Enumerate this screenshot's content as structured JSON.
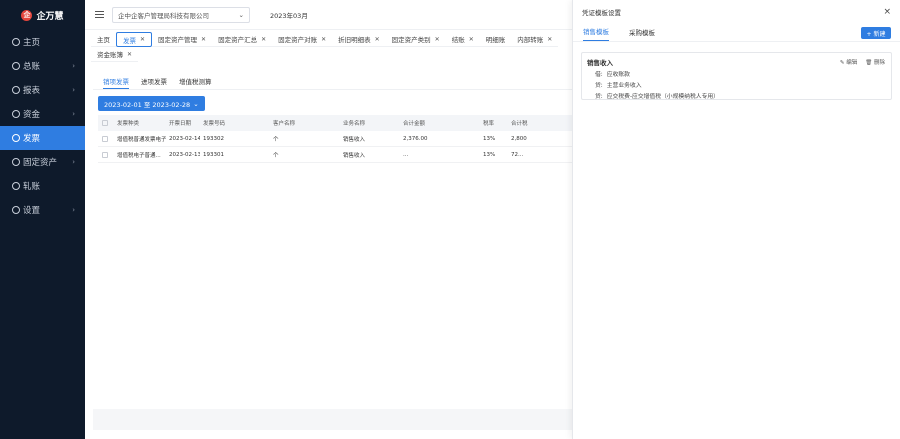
{
  "sidebar": {
    "logo": "企万慧",
    "items": [
      {
        "label": "主页",
        "arrow": ""
      },
      {
        "label": "总账",
        "arrow": "›"
      },
      {
        "label": "报表",
        "arrow": "›"
      },
      {
        "label": "资金",
        "arrow": "›"
      },
      {
        "label": "发票",
        "arrow": ""
      },
      {
        "label": "固定资产",
        "arrow": "›"
      },
      {
        "label": "轧账",
        "arrow": ""
      },
      {
        "label": "设置",
        "arrow": "›"
      }
    ]
  },
  "topbar": {
    "company": "企中企客户管理局科技有限公司",
    "period": "2023年03月"
  },
  "tabs": [
    {
      "label": "主页",
      "closable": false
    },
    {
      "label": "发票",
      "closable": true
    },
    {
      "label": "固定资产管理",
      "closable": true
    },
    {
      "label": "固定资产汇总",
      "closable": true
    },
    {
      "label": "固定资产对账",
      "closable": true
    },
    {
      "label": "折旧明细表",
      "closable": true
    },
    {
      "label": "固定资产类别",
      "closable": true
    },
    {
      "label": "结账",
      "closable": true
    },
    {
      "label": "明细账",
      "closable": false
    },
    {
      "label": "内部转账",
      "closable": true
    },
    {
      "label": "资金账簿",
      "closable": true
    }
  ],
  "subtabs": [
    "销项发票",
    "进项发票",
    "增值税测算"
  ],
  "date_range": "2023-02-01 至 2023-02-28",
  "table": {
    "headers": [
      "发票种类",
      "开票日期",
      "发票号码",
      "客户名称",
      "业务名称",
      "合计金额",
      "税率",
      "合计税"
    ],
    "rows": [
      [
        "增值税普通发票电子...",
        "2023-02-14",
        "193302",
        "个",
        "销售收入",
        "2,376.00",
        "13%",
        "2,800"
      ],
      [
        "增值税电子普通...",
        "2023-02-13",
        "193301",
        "个",
        "销售收入",
        "...",
        "13%",
        "72..."
      ]
    ]
  },
  "drawer": {
    "title": "凭证模板设置",
    "close": "×",
    "tabs": [
      "销售模板",
      "采购模板"
    ],
    "new_button": "+ 新建",
    "card": {
      "title": "销售收入",
      "edit": "编辑",
      "delete": "删除",
      "entries": [
        {
          "side": "借:",
          "text": "应收账款"
        },
        {
          "side": "贷:",
          "text": "主营业务收入"
        },
        {
          "side": "贷:",
          "text": "应交税费-应交增值税（小规模纳税人专用）"
        }
      ]
    }
  }
}
